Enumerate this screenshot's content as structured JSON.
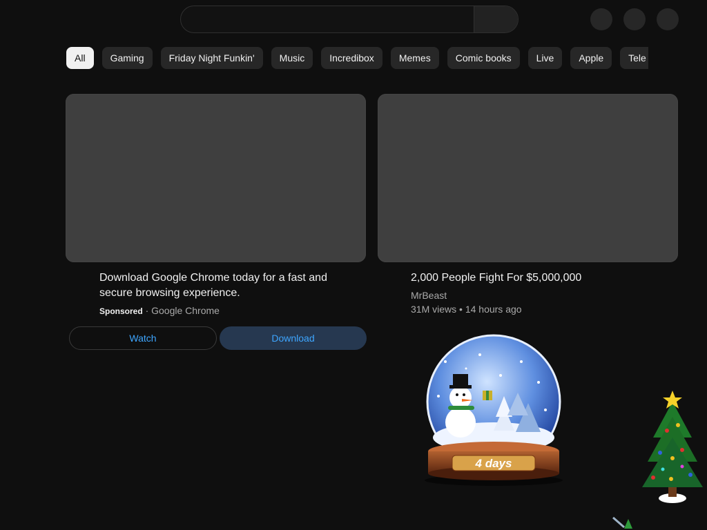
{
  "search": {
    "placeholder": "",
    "value": ""
  },
  "chips": [
    "All",
    "Gaming",
    "Friday Night Funkin'",
    "Music",
    "Incredibox",
    "Memes",
    "Comic books",
    "Live",
    "Apple",
    "Tele"
  ],
  "ad": {
    "title": "Download Google Chrome today for a fast and secure browsing experience.",
    "sponsored_label": "Sponsored",
    "separator": "·",
    "advertiser": "Google Chrome",
    "watch_label": "Watch",
    "download_label": "Download"
  },
  "video": {
    "title": "2,000 People Fight For $5,000,000",
    "channel": "MrBeast",
    "views": "31M views",
    "separator": "•",
    "age": "14 hours ago"
  },
  "snow_globe": {
    "countdown": "4 days"
  },
  "colors": {
    "background": "#0f0f0f",
    "chip": "#272727",
    "chip_active": "#f1f1f1",
    "thumbnail": "#3f3f3f",
    "link_blue": "#3ea6ff",
    "download_bg": "#263850"
  },
  "icons": [
    "search-icon",
    "snow-globe",
    "christmas-tree"
  ]
}
